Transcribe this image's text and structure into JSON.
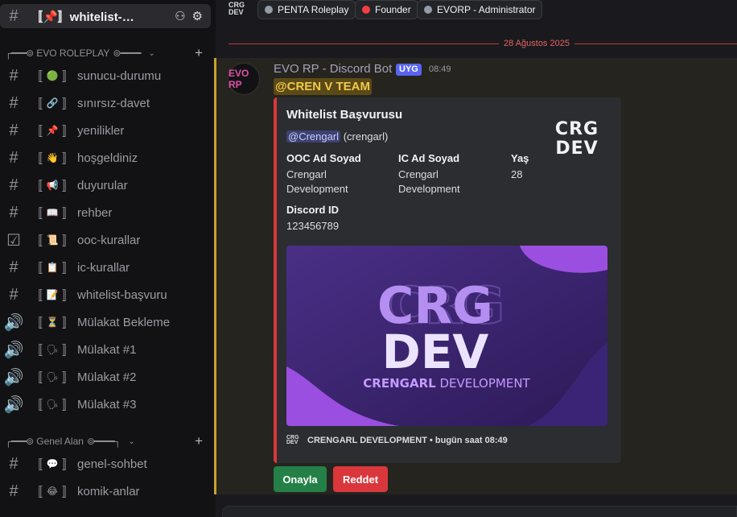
{
  "sidebar": {
    "active_channel": {
      "label": "〚📌〛whitelist-başv...",
      "icon": "text-channel-icon"
    },
    "category1": {
      "label": "EVO ROLEPLAY",
      "deco_left": "┌━━━⊚",
      "deco_right": "⊚━━━━"
    },
    "category2": {
      "label": "Genel Alan",
      "deco_left": "┌━━━⊚",
      "deco_right": "⊚━━━━┐"
    },
    "channels": [
      {
        "emoji": "🟢",
        "label": "sunucu-durumu",
        "type": "text"
      },
      {
        "emoji": "🔗",
        "label": "sınırsız-davet",
        "type": "text"
      },
      {
        "emoji": "📌",
        "label": "yenilikler",
        "type": "text"
      },
      {
        "emoji": "👋",
        "label": "hoşgeldiniz",
        "type": "text"
      },
      {
        "emoji": "📢",
        "label": "duyurular",
        "type": "text"
      },
      {
        "emoji": "📖",
        "label": "rehber",
        "type": "text"
      },
      {
        "emoji": "📜",
        "label": "ooc-kurallar",
        "type": "rules"
      },
      {
        "emoji": "📋",
        "label": "ic-kurallar",
        "type": "text"
      },
      {
        "emoji": "📝",
        "label": "whitelist-başvuru",
        "type": "text"
      },
      {
        "emoji": "⏳",
        "label": "Mülakat Bekleme",
        "type": "voice"
      },
      {
        "emoji": "🗣",
        "label": "Mülakat #1",
        "type": "voice"
      },
      {
        "emoji": "🗣",
        "label": "Mülakat #2",
        "type": "voice"
      },
      {
        "emoji": "🗣",
        "label": "Mülakat #3",
        "type": "voice"
      }
    ],
    "channels2": [
      {
        "emoji": "💬",
        "label": "genel-sohbet",
        "type": "text"
      },
      {
        "emoji": "😂",
        "label": "komik-anlar",
        "type": "text"
      }
    ]
  },
  "topbar": {
    "roles": [
      {
        "label": "PENTA Roleplay",
        "color": "#949ba4"
      },
      {
        "label": "Founder",
        "color": "#f23f43"
      },
      {
        "label": "EVORP - Administrator",
        "color": "#949ba4"
      }
    ],
    "server_logo_text": "CRG DEV"
  },
  "date_separator": "28 Ağustos 2025",
  "message": {
    "avatar_text": "EVO RP",
    "author": "EVO RP - Discord Bot",
    "app_tag": "UYG",
    "time": "08:49",
    "mention": "@CREN V TEAM",
    "embed": {
      "accent_color": "#da373c",
      "title": "Whitelist Başvurusu",
      "user_mention": "@Crengarl",
      "user_name": "(crengarl)",
      "fields": [
        {
          "name": "OOC Ad Soyad",
          "value": "Crengarl Development"
        },
        {
          "name": "IC Ad Soyad",
          "value": "Crengarl Development"
        },
        {
          "name": "Yaş",
          "value": "28"
        },
        {
          "name": "Discord ID",
          "value": "123456789"
        }
      ],
      "thumbnail_text": "CRG DEV",
      "image": {
        "logo_top": "CRG",
        "logo_bottom": "DEV",
        "caption_bold": "CRENGARL",
        "caption_light": "DEVELOPMENT"
      },
      "footer": "CRENGARL DEVELOPMENT • bugün saat 08:49"
    },
    "buttons": {
      "approve": "Onayla",
      "reject": "Reddet"
    }
  }
}
